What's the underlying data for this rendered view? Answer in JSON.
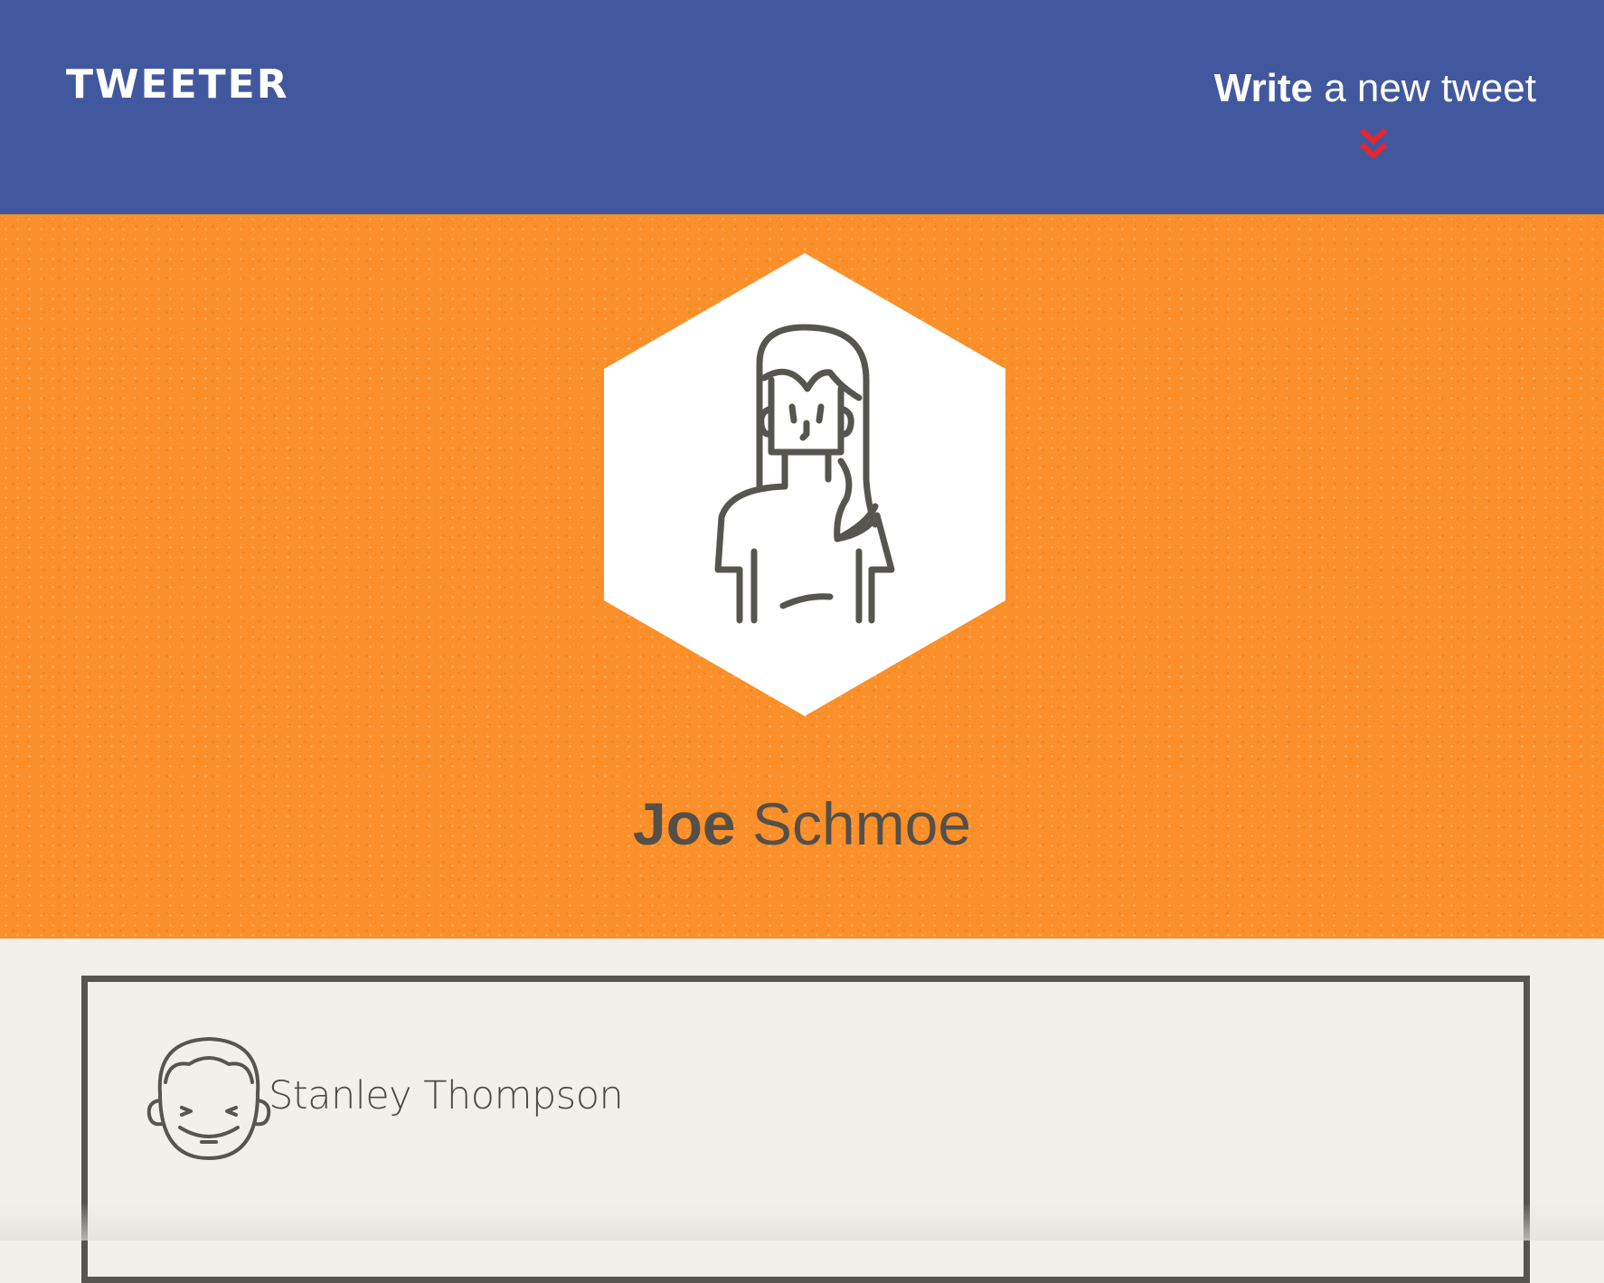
{
  "header": {
    "logo": "TWEETER",
    "write_link": {
      "bold_word": "Write",
      "rest": " a new tweet"
    },
    "chevron_icon": "double-chevron-down-icon",
    "colors": {
      "background": "#42589e",
      "chevron": "#e8242e"
    }
  },
  "profile": {
    "first_name": "Joe",
    "last_name": " Schmoe",
    "avatar_icon": "woman-avatar-icon",
    "colors": {
      "hero_background": "#fb8f29",
      "avatar_stroke": "#575550"
    }
  },
  "tweets": [
    {
      "author": "Stanley Thompson",
      "avatar_icon": "man-avatar-icon"
    }
  ]
}
